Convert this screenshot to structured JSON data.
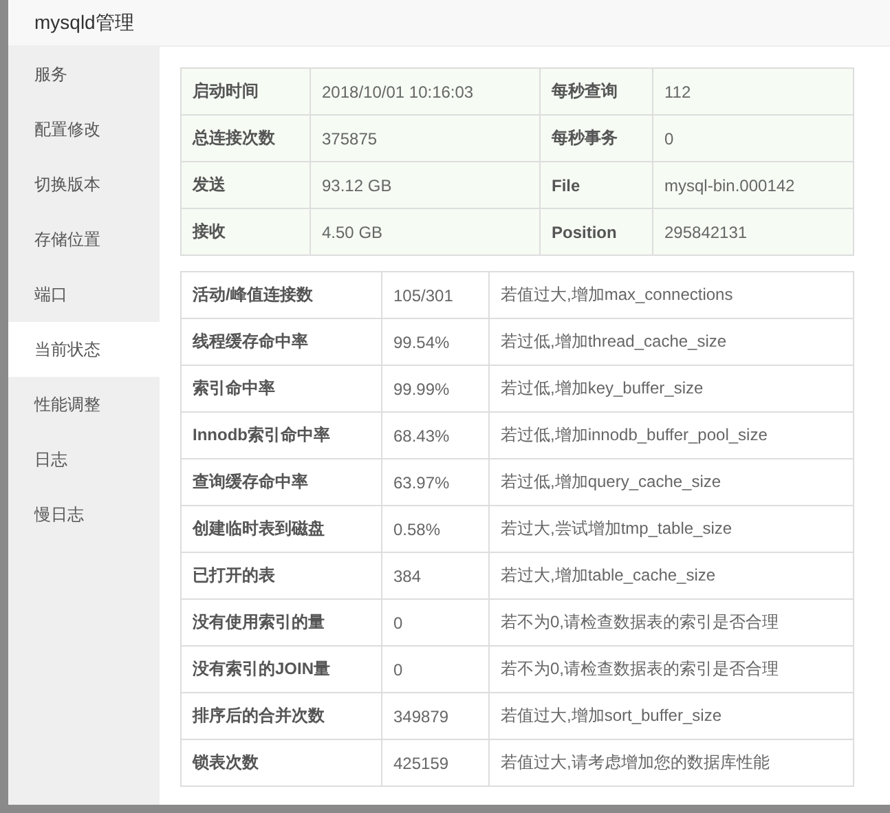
{
  "window": {
    "title": "mysqld管理"
  },
  "sidebar": {
    "items": [
      {
        "label": "服务",
        "selected": false
      },
      {
        "label": "配置修改",
        "selected": false
      },
      {
        "label": "切换版本",
        "selected": false
      },
      {
        "label": "存储位置",
        "selected": false
      },
      {
        "label": "端口",
        "selected": false
      },
      {
        "label": "当前状态",
        "selected": true
      },
      {
        "label": "性能调整",
        "selected": false
      },
      {
        "label": "日志",
        "selected": false
      },
      {
        "label": "慢日志",
        "selected": false
      }
    ]
  },
  "summary_table": {
    "rows": [
      [
        "启动时间",
        "2018/10/01 10:16:03",
        "每秒查询",
        "112"
      ],
      [
        "总连接次数",
        "375875",
        "每秒事务",
        "0"
      ],
      [
        "发送",
        "93.12 GB",
        "File",
        "mysql-bin.000142"
      ],
      [
        "接收",
        "4.50 GB",
        "Position",
        "295842131"
      ]
    ]
  },
  "status_table": {
    "rows": [
      [
        "活动/峰值连接数",
        "105/301",
        "若值过大,增加max_connections"
      ],
      [
        "线程缓存命中率",
        "99.54%",
        "若过低,增加thread_cache_size"
      ],
      [
        "索引命中率",
        "99.99%",
        "若过低,增加key_buffer_size"
      ],
      [
        "Innodb索引命中率",
        "68.43%",
        "若过低,增加innodb_buffer_pool_size"
      ],
      [
        "查询缓存命中率",
        "63.97%",
        "若过低,增加query_cache_size"
      ],
      [
        "创建临时表到磁盘",
        "0.58%",
        "若过大,尝试增加tmp_table_size"
      ],
      [
        "已打开的表",
        "384",
        "若过大,增加table_cache_size"
      ],
      [
        "没有使用索引的量",
        "0",
        "若不为0,请检查数据表的索引是否合理"
      ],
      [
        "没有索引的JOIN量",
        "0",
        "若不为0,请检查数据表的索引是否合理"
      ],
      [
        "排序后的合并次数",
        "349879",
        "若值过大,增加sort_buffer_size"
      ],
      [
        "锁表次数",
        "425159",
        "若值过大,请考虑增加您的数据库性能"
      ]
    ]
  }
}
